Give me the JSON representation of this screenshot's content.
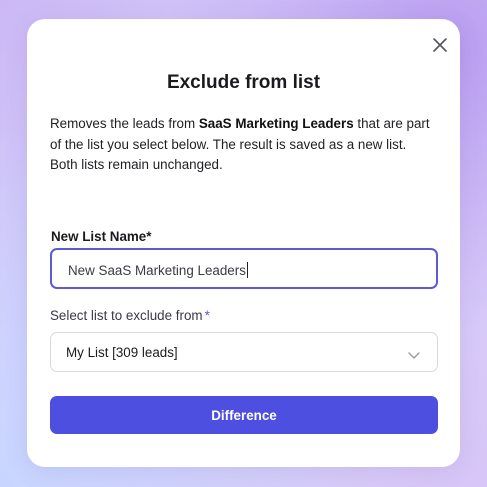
{
  "modal": {
    "title": "Exclude from list",
    "close_icon": "close-icon",
    "description": {
      "part1": "Removes the leads from ",
      "list_name": "SaaS Marketing Leaders",
      "part2": " that are part of the list you select below. The result is saved as a new list.",
      "line2": "Both lists remain unchanged."
    },
    "new_list": {
      "label": "New List Name",
      "required_mark": "*",
      "value": "New SaaS Marketing Leaders"
    },
    "exclude_list": {
      "label": "Select list to exclude from",
      "required_mark": "*",
      "selected": "My List [309 leads]",
      "icon": "chevron-down-icon"
    },
    "submit_label": "Difference"
  },
  "colors": {
    "accent": "#4c4fe0",
    "input_focus_border": "#5b5bd6"
  }
}
